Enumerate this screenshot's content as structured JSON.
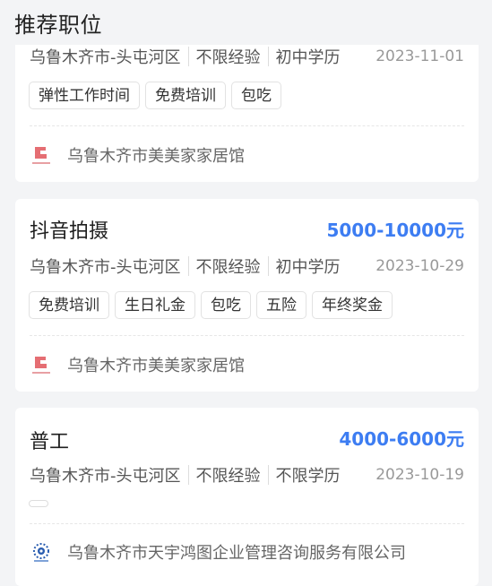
{
  "header": {
    "title": "推荐职位"
  },
  "jobs": [
    {
      "title": "",
      "salary": "",
      "location": "乌鲁木齐市-头屯河区",
      "experience": "不限经验",
      "education": "初中学历",
      "date": "2023-11-01",
      "tags": [
        "弹性工作时间",
        "免费培训",
        "包吃"
      ],
      "company": "乌鲁木齐市美美家家居馆"
    },
    {
      "title": "抖音拍摄",
      "salary": "5000-10000元",
      "location": "乌鲁木齐市-头屯河区",
      "experience": "不限经验",
      "education": "初中学历",
      "date": "2023-10-29",
      "tags": [
        "免费培训",
        "生日礼金",
        "包吃",
        "五险",
        "年终奖金"
      ],
      "company": "乌鲁木齐市美美家家居馆"
    },
    {
      "title": "普工",
      "salary": "4000-6000元",
      "location": "乌鲁木齐市-头屯河区",
      "experience": "不限经验",
      "education": "不限学历",
      "date": "2023-10-19",
      "tags": [],
      "company": "乌鲁木齐市天宇鸿图企业管理咨询服务有限公司"
    }
  ],
  "colors": {
    "accent": "#3d7df2",
    "logo_red": "#e0555a",
    "logo_blue": "#2a5db0"
  }
}
